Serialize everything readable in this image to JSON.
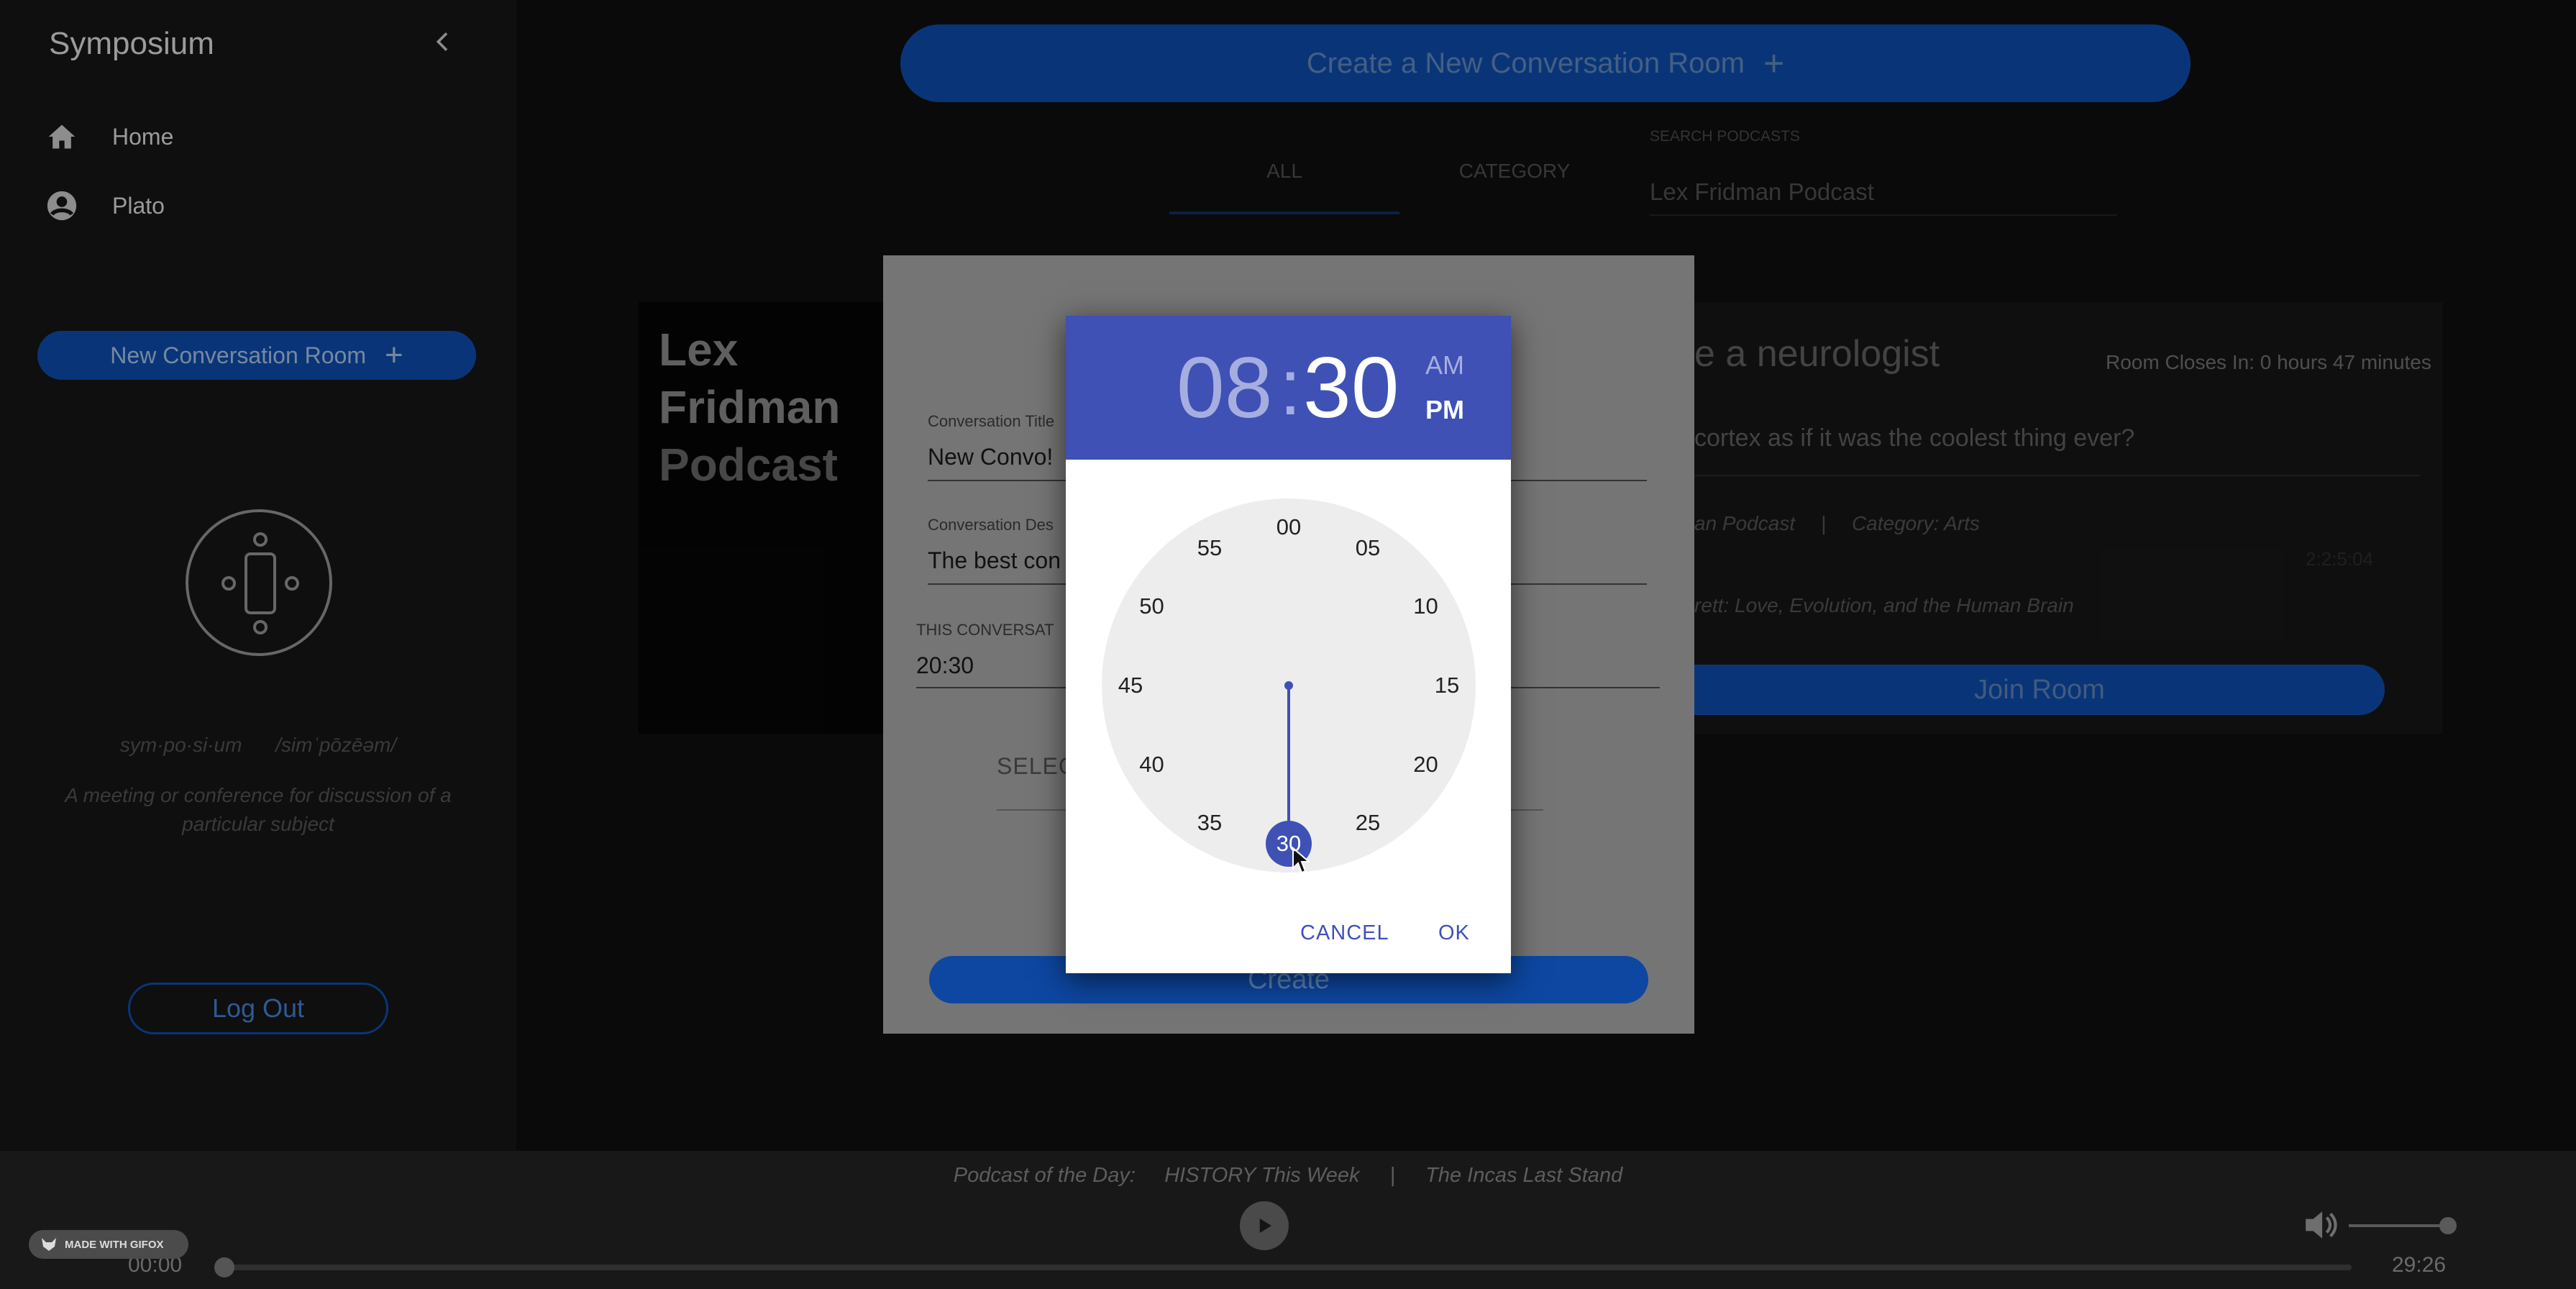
{
  "app": {
    "title": "Symposium"
  },
  "sidebar": {
    "nav": [
      {
        "label": "Home",
        "icon": "home-icon"
      },
      {
        "label": "Plato",
        "icon": "account-circle-icon"
      }
    ],
    "new_room_label": "New Conversation Room",
    "definition": {
      "word": "sym·po·si·um",
      "pronunciation": "/simˈpōzēəm/",
      "meaning": "A meeting or conference for discussion of a particular subject"
    },
    "logout_label": "Log Out"
  },
  "main": {
    "create_room_label": "Create a New Conversation Room",
    "tabs": [
      {
        "label": "ALL"
      },
      {
        "label": "CATEGORY"
      }
    ],
    "search": {
      "label": "SEARCH PODCASTS",
      "value": "Lex Fridman Podcast"
    },
    "podcast_image_text": {
      "line1": "Lex",
      "line2": "Fridman",
      "line3": "Podcast"
    },
    "room_card": {
      "title_fragment": "e a neurologist",
      "closes": "Room Closes In: 0 hours 47 minutes",
      "description_fragment": "cortex as if it was the coolest thing ever?",
      "podcast_fragment": "an Podcast",
      "separator": "|",
      "category": "Category: Arts",
      "timestamp": "2:2:5:04",
      "episode_fragment": "rett: Love, Evolution, and the Human Brain",
      "join_label": "Join Room"
    }
  },
  "form": {
    "title_label": "Conversation Title",
    "title_value": "New Convo!",
    "desc_label": "Conversation Des",
    "desc_value": "The best con",
    "time_label": "THIS CONVERSAT",
    "time_value": "20:30",
    "select_label": "SELEC",
    "create_label": "Create"
  },
  "time_picker": {
    "hours": "08",
    "colon": ":",
    "minutes": "30",
    "am": "AM",
    "pm": "PM",
    "selected_period": "PM",
    "selected_minute": 30,
    "minute_labels": [
      "00",
      "05",
      "10",
      "15",
      "20",
      "25",
      "30",
      "35",
      "40",
      "45",
      "50",
      "55"
    ],
    "cancel_label": "CANCEL",
    "ok_label": "OK"
  },
  "player": {
    "podcast_of_day_label": "Podcast of the Day:",
    "show": "HISTORY This Week",
    "separator": "|",
    "episode": "The Incas Last Stand",
    "current_time": "00:00",
    "duration": "29:26",
    "progress": 0,
    "volume": 1.0,
    "gifox_badge": "MADE WITH GIFOX"
  },
  "colors": {
    "accent": "#3f51b5",
    "primary_button": "#0d47a1",
    "background": "#0b0b0b"
  }
}
